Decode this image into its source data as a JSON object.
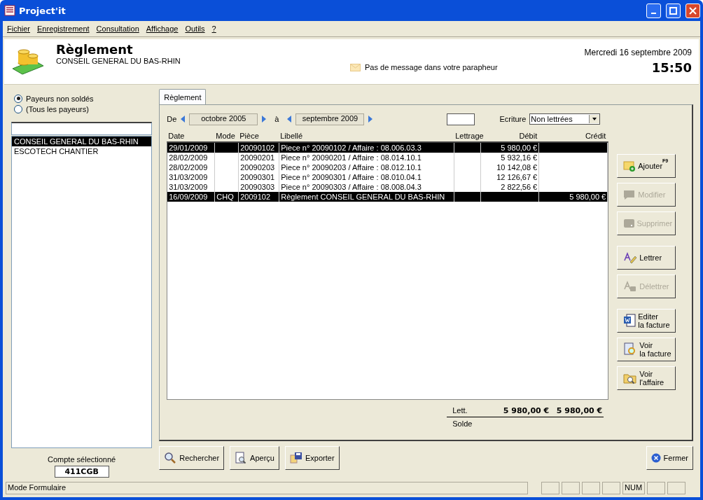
{
  "window": {
    "title": "Project'it"
  },
  "menu": [
    "Fichier",
    "Enregistrement",
    "Consultation",
    "Affichage",
    "Outils",
    "?"
  ],
  "header": {
    "title": "Règlement",
    "subtitle": "CONSEIL GENERAL DU BAS-RHIN",
    "message": "Pas de message dans votre parapheur",
    "date": "Mercredi 16 septembre 2009",
    "time": "15:50"
  },
  "payer_filter": [
    {
      "label": "Payeurs non soldés",
      "selected": true
    },
    {
      "label": "(Tous les payeurs)",
      "selected": false
    }
  ],
  "payers": [
    {
      "name": "CONSEIL GENERAL DU BAS-RHIN",
      "selected": true
    },
    {
      "name": "ESCOTECH CHANTIER",
      "selected": false
    }
  ],
  "selected_account": {
    "label": "Compte sélectionné",
    "value": "411CGB"
  },
  "tabs": [
    {
      "label": "Règlement",
      "selected": true
    }
  ],
  "period": {
    "from_label": "De",
    "from": "octobre 2005",
    "to_label": "à",
    "to": "septembre 2009"
  },
  "ecriture": {
    "label": "Ecriture",
    "value": "Non lettrées"
  },
  "table": {
    "columns": [
      "Date",
      "Mode",
      "Pièce",
      "Libellé",
      "Lettrage",
      "Débit",
      "Crédit"
    ],
    "rows": [
      {
        "date": "29/01/2009",
        "piece": "20090102",
        "libelle": "Piece n° 20090102 / Affaire : 08.006.03.3",
        "debit": "5 980,00 €",
        "selected": true
      },
      {
        "date": "28/02/2009",
        "piece": "20090201",
        "libelle": "Piece n° 20090201 / Affaire : 08.014.10.1",
        "debit": "5 932,16 €",
        "selected": false
      },
      {
        "date": "28/02/2009",
        "piece": "20090203",
        "libelle": "Piece n° 20090203 / Affaire : 08.012.10.1",
        "debit": "10 142,08 €",
        "selected": false
      },
      {
        "date": "31/03/2009",
        "piece": "20090301",
        "libelle": "Piece n° 20090301 / Affaire : 08.010.04.1",
        "debit": "12 126,67 €",
        "selected": false
      },
      {
        "date": "31/03/2009",
        "piece": "20090303",
        "libelle": "Piece n° 20090303 / Affaire : 08.008.04.3",
        "debit": "2 822,56 €",
        "selected": false
      },
      {
        "date": "16/09/2009",
        "mode": "CHQ",
        "piece": "2009102",
        "libelle": "Règlement CONSEIL GENERAL DU BAS-RHIN",
        "credit": "5 980,00 €",
        "selected": true
      }
    ]
  },
  "totals": {
    "label": "Lett.",
    "debit": "5 980,00 €",
    "credit": "5 980,00 €",
    "balance_label": "Solde"
  },
  "actions": [
    {
      "kind": "add",
      "lines": [
        "Ajouter"
      ],
      "shortcut": "F9",
      "disabled": false
    },
    {
      "kind": "edit",
      "lines": [
        "Modifier"
      ],
      "disabled": true
    },
    {
      "kind": "delete",
      "lines": [
        "Supprimer"
      ],
      "disabled": true
    },
    {
      "kind": "letter",
      "lines": [
        "Lettrer"
      ],
      "disabled": false
    },
    {
      "kind": "unletter",
      "lines": [
        "Délettrer"
      ],
      "disabled": true
    },
    {
      "kind": "document",
      "lines": [
        "Editer",
        "la facture"
      ],
      "disabled": false
    },
    {
      "kind": "view",
      "lines": [
        "Voir",
        "la facture"
      ],
      "disabled": false
    },
    {
      "kind": "folder",
      "lines": [
        "Voir",
        "l'affaire"
      ],
      "disabled": false
    }
  ],
  "bottom_buttons": [
    {
      "kind": "search",
      "label": "Rechercher"
    },
    {
      "kind": "preview",
      "label": "Aperçu"
    },
    {
      "kind": "export",
      "label": "Exporter"
    }
  ],
  "close_button": {
    "label": "Fermer"
  },
  "status_bar": {
    "mode": "Mode Formulaire",
    "num": "NUM"
  }
}
